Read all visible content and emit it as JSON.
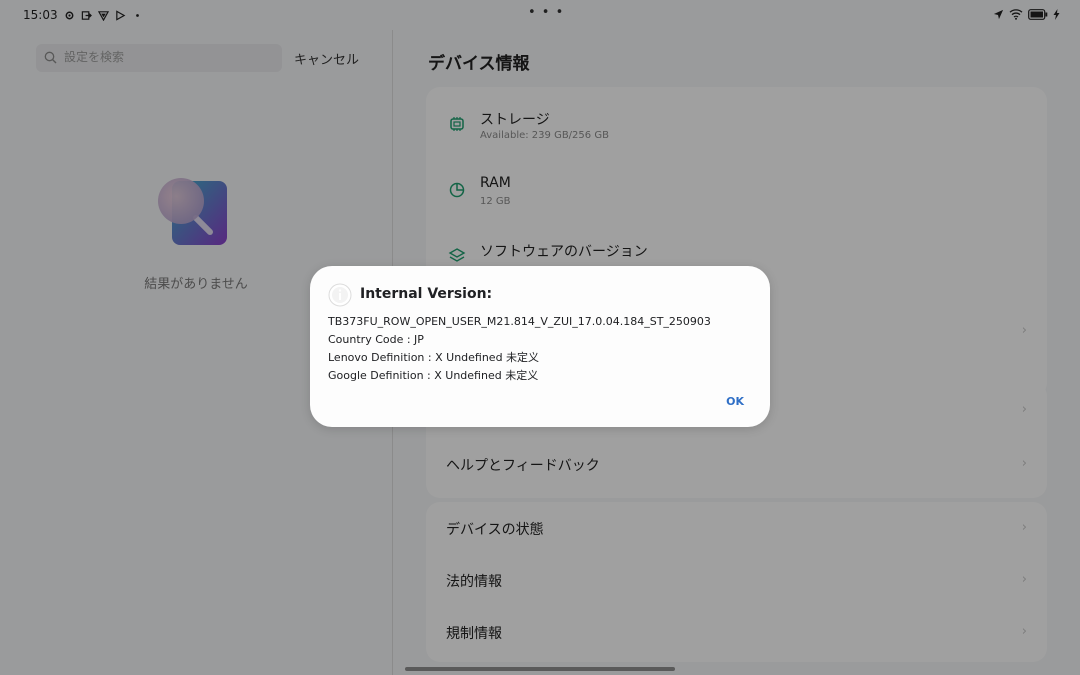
{
  "status_bar": {
    "time": "15:03",
    "left_icons": [
      "settings-icon",
      "sign-in-icon",
      "vpn-shield-icon",
      "play-store-icon",
      "dot-icon"
    ],
    "center": "• • •",
    "right_icons": [
      "location-icon",
      "wifi-icon",
      "battery-icon",
      "charging-icon"
    ]
  },
  "left_pane": {
    "search_placeholder": "設定を検索",
    "cancel_label": "キャンセル",
    "empty_text": "結果がありません"
  },
  "right_pane": {
    "title": "デバイス情報",
    "info_items": [
      {
        "label": "ストレージ",
        "sub": "Available: 239 GB/256 GB",
        "icon": "storage-icon"
      },
      {
        "label": "RAM",
        "sub": "12 GB",
        "icon": "ram-icon"
      },
      {
        "label": "ソフトウェアのバージョン",
        "sub": "",
        "icon": "software-icon"
      }
    ],
    "menu_rows": {
      "help_feedback": "ヘルプとフィードバック",
      "device_status": "デバイスの状態",
      "legal_info": "法的情報",
      "regulatory_info": "規制情報"
    }
  },
  "dialog": {
    "title": "Internal Version:",
    "lines": [
      "TB373FU_ROW_OPEN_USER_M21.814_V_ZUI_17.0.04.184_ST_250903",
      "Country Code : JP",
      "Lenovo Definition : X Undefined 未定义",
      "Google Definition : X Undefined 未定义"
    ],
    "ok_label": "OK"
  },
  "colors": {
    "accent": "#2f6fc6",
    "icon_green": "#1f9d6e",
    "scrim": "rgba(0,0,0,0.36)"
  }
}
